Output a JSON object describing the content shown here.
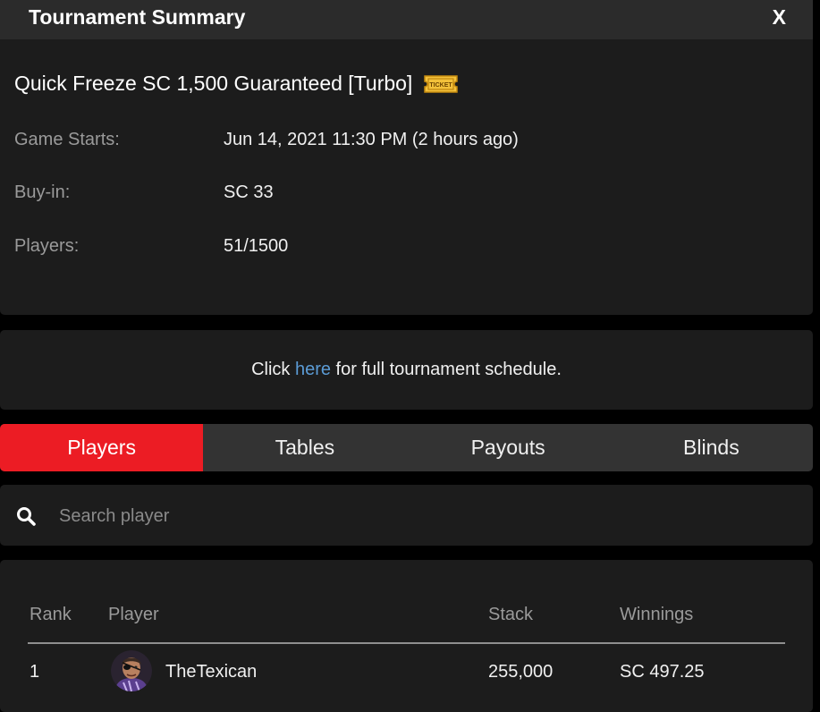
{
  "header": {
    "title": "Tournament Summary",
    "close_label": "X"
  },
  "summary": {
    "tournament_name": "Quick Freeze SC 1,500 Guaranteed [Turbo]",
    "ticket_badge": "TICKET",
    "rows": [
      {
        "label": "Game Starts:",
        "value": "Jun 14, 2021 11:30 PM (2 hours ago)"
      },
      {
        "label": "Buy-in:",
        "value": "SC 33"
      },
      {
        "label": "Players:",
        "value": "51/1500"
      }
    ]
  },
  "schedule": {
    "prefix": "Click ",
    "link_text": "here",
    "suffix": " for full tournament schedule."
  },
  "tabs": [
    {
      "label": "Players",
      "active": true
    },
    {
      "label": "Tables",
      "active": false
    },
    {
      "label": "Payouts",
      "active": false
    },
    {
      "label": "Blinds",
      "active": false
    }
  ],
  "search": {
    "placeholder": "Search player",
    "value": ""
  },
  "players_table": {
    "columns": [
      "Rank",
      "Player",
      "Stack",
      "Winnings"
    ],
    "rows": [
      {
        "rank": "1",
        "player": "TheTexican",
        "stack": "255,000",
        "winnings": "SC 497.25"
      }
    ]
  },
  "colors": {
    "accent": "#ec1c24",
    "link": "#5b9bd5",
    "ticket": "#f3c13a"
  }
}
